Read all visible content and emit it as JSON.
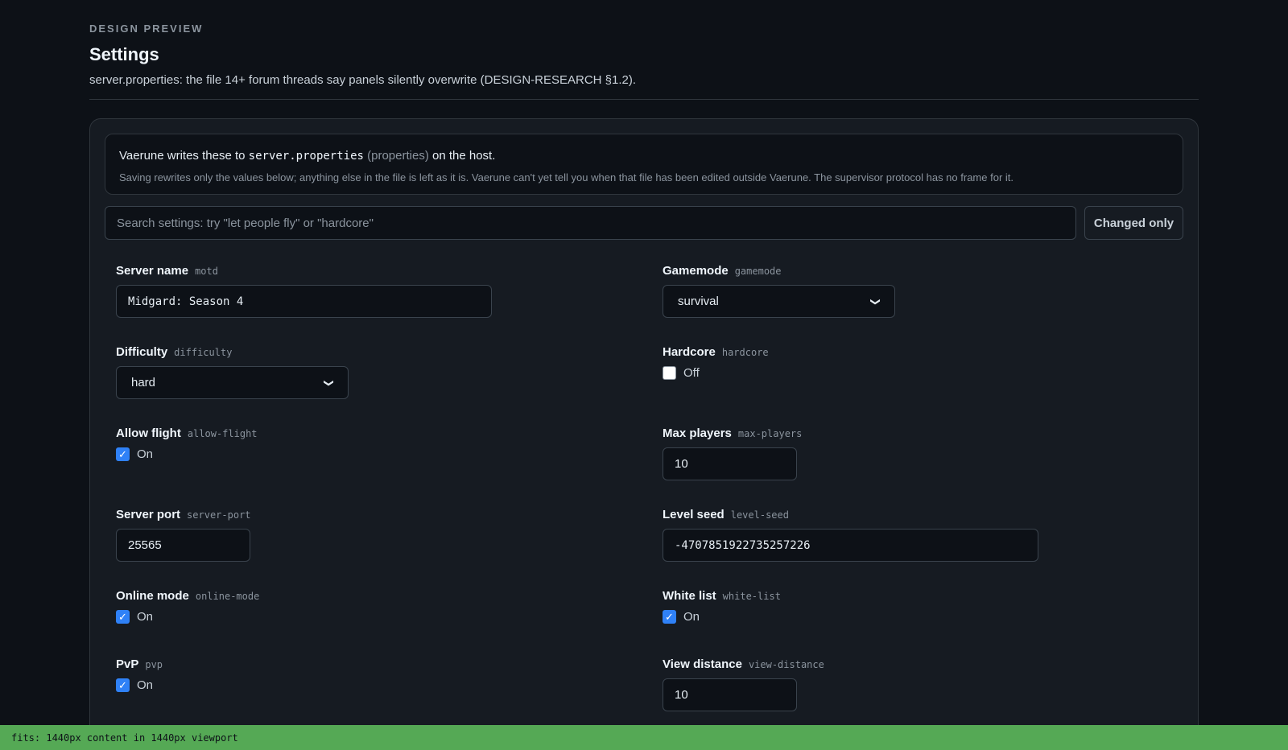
{
  "header": {
    "eyebrow": "DESIGN PREVIEW",
    "title": "Settings",
    "subtitle": "server.properties: the file 14+ forum threads say panels silently overwrite (DESIGN-RESEARCH §1.2)."
  },
  "notice": {
    "prefix": "Vaerune writes these to",
    "filename": "server.properties",
    "paren": "(properties)",
    "suffix": "on the host.",
    "detail": "Saving rewrites only the values below; anything else in the file is left as it is. Vaerune can't yet tell you when that file has been edited outside Vaerune. The supervisor protocol has no frame for it."
  },
  "search": {
    "placeholder": "Search settings: try \"let people fly\" or \"hardcore\"",
    "value": ""
  },
  "changed_only_label": "Changed only",
  "fields": {
    "motd": {
      "label": "Server name",
      "key": "motd",
      "value": "Midgard: Season 4"
    },
    "gamemode": {
      "label": "Gamemode",
      "key": "gamemode",
      "value": "survival"
    },
    "difficulty": {
      "label": "Difficulty",
      "key": "difficulty",
      "value": "hard"
    },
    "hardcore": {
      "label": "Hardcore",
      "key": "hardcore",
      "state": "Off"
    },
    "allow_flight": {
      "label": "Allow flight",
      "key": "allow-flight",
      "state": "On"
    },
    "max_players": {
      "label": "Max players",
      "key": "max-players",
      "value": "10"
    },
    "server_port": {
      "label": "Server port",
      "key": "server-port",
      "value": "25565"
    },
    "level_seed": {
      "label": "Level seed",
      "key": "level-seed",
      "value": "-4707851922735257226"
    },
    "online_mode": {
      "label": "Online mode",
      "key": "online-mode",
      "state": "On"
    },
    "white_list": {
      "label": "White list",
      "key": "white-list",
      "state": "On"
    },
    "pvp": {
      "label": "PvP",
      "key": "pvp",
      "state": "On"
    },
    "view_distance": {
      "label": "View distance",
      "key": "view-distance",
      "value": "10"
    }
  },
  "check_mark": "✓",
  "chevron": "❯",
  "status_bar": "fits: 1440px content in 1440px viewport",
  "colors": {
    "background": "#0d1117",
    "panel": "#161b22",
    "accent": "#2f81f7",
    "status_bar": "#55a955"
  }
}
